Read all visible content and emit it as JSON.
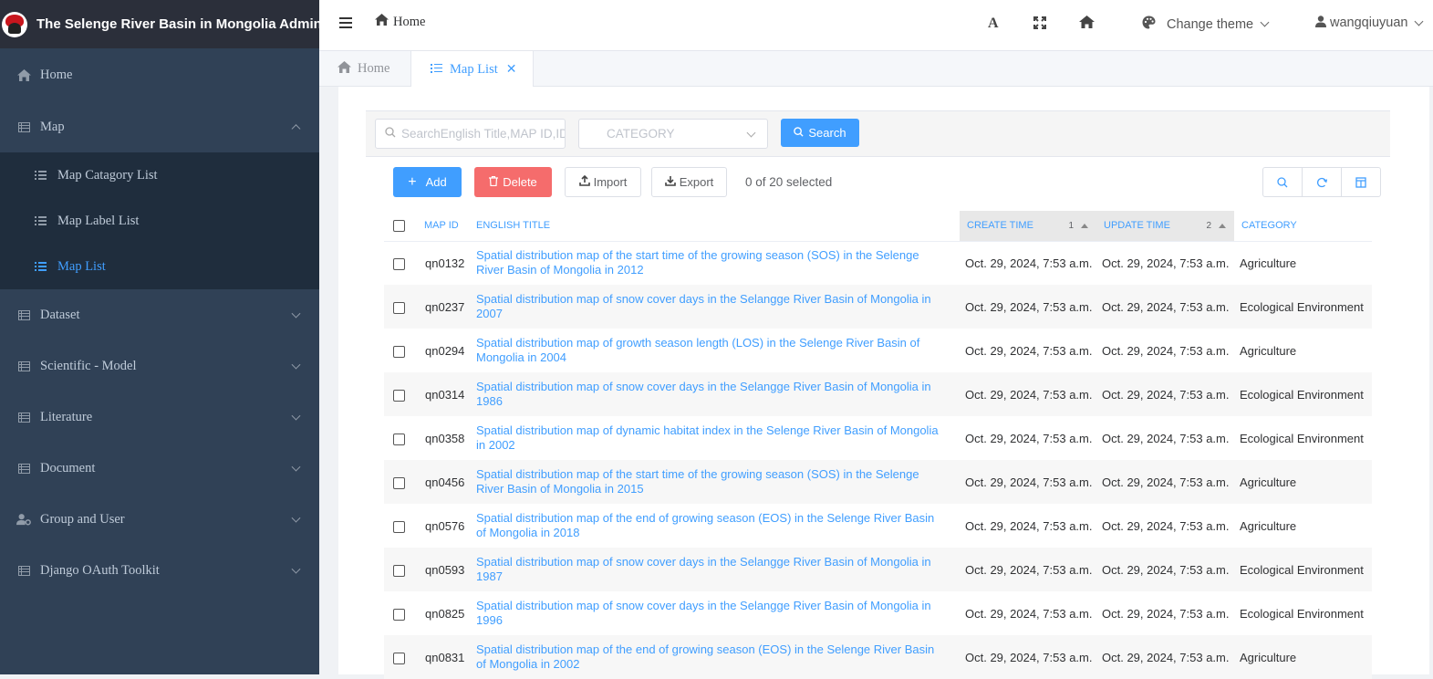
{
  "brand": {
    "title": "The Selenge River Basin in Mongolia Admin"
  },
  "sidebar": {
    "home": "Home",
    "map": "Map",
    "map_sub": [
      {
        "label": "Map Catagory List",
        "active": false
      },
      {
        "label": "Map Label List",
        "active": false
      },
      {
        "label": "Map List",
        "active": true
      }
    ],
    "sections": [
      "Dataset",
      "Scientific - Model",
      "Literature",
      "Document",
      "Group and User",
      "Django OAuth Toolkit"
    ]
  },
  "header": {
    "breadcrumb": "Home",
    "theme": "Change theme",
    "user": "wangqiuyuan",
    "font_icon": "A"
  },
  "tabs": {
    "home": "Home",
    "active": "Map List",
    "close": "✕"
  },
  "filter": {
    "search_placeholder": "SearchEnglish Title,MAP ID,ID",
    "category_placeholder": "CATEGORY",
    "search_button": "Search"
  },
  "toolbar": {
    "add": "Add",
    "delete": "Delete",
    "import": "Import",
    "export": "Export",
    "selected": "0 of 20 selected"
  },
  "table": {
    "headers": {
      "map_id": "MAP ID",
      "english_title": "ENGLISH TITLE",
      "create_time": "CREATE TIME",
      "create_sort": "1",
      "update_time": "UPDATE TIME",
      "update_sort": "2",
      "category": "CATEGORY"
    },
    "rows": [
      {
        "id": "qn0132",
        "title": "Spatial distribution map of the start time of the growing season (SOS) in the Selenge River Basin of Mongolia in 2012",
        "create": "Oct. 29, 2024, 7:53 a.m.",
        "update": "Oct. 29, 2024, 7:53 a.m.",
        "category": "Agriculture"
      },
      {
        "id": "qn0237",
        "title": "Spatial distribution map of snow cover days in the Selangge River Basin of Mongolia in 2007",
        "create": "Oct. 29, 2024, 7:53 a.m.",
        "update": "Oct. 29, 2024, 7:53 a.m.",
        "category": "Ecological Environment"
      },
      {
        "id": "qn0294",
        "title": "Spatial distribution map of growth season length (LOS) in the Selenge River Basin of Mongolia in 2004",
        "create": "Oct. 29, 2024, 7:53 a.m.",
        "update": "Oct. 29, 2024, 7:53 a.m.",
        "category": "Agriculture"
      },
      {
        "id": "qn0314",
        "title": "Spatial distribution map of snow cover days in the Selangge River Basin of Mongolia in 1986",
        "create": "Oct. 29, 2024, 7:53 a.m.",
        "update": "Oct. 29, 2024, 7:53 a.m.",
        "category": "Ecological Environment"
      },
      {
        "id": "qn0358",
        "title": "Spatial distribution map of dynamic habitat index in the Selenge River Basin of Mongolia in 2002",
        "create": "Oct. 29, 2024, 7:53 a.m.",
        "update": "Oct. 29, 2024, 7:53 a.m.",
        "category": "Ecological Environment"
      },
      {
        "id": "qn0456",
        "title": "Spatial distribution map of the start time of the growing season (SOS) in the Selenge River Basin of Mongolia in 2015",
        "create": "Oct. 29, 2024, 7:53 a.m.",
        "update": "Oct. 29, 2024, 7:53 a.m.",
        "category": "Agriculture"
      },
      {
        "id": "qn0576",
        "title": "Spatial distribution map of the end of growing season (EOS) in the Selenge River Basin of Mongolia in 2018",
        "create": "Oct. 29, 2024, 7:53 a.m.",
        "update": "Oct. 29, 2024, 7:53 a.m.",
        "category": "Agriculture"
      },
      {
        "id": "qn0593",
        "title": "Spatial distribution map of snow cover days in the Selangge River Basin of Mongolia in 1987",
        "create": "Oct. 29, 2024, 7:53 a.m.",
        "update": "Oct. 29, 2024, 7:53 a.m.",
        "category": "Ecological Environment"
      },
      {
        "id": "qn0825",
        "title": "Spatial distribution map of snow cover days in the Selangge River Basin of Mongolia in 1996",
        "create": "Oct. 29, 2024, 7:53 a.m.",
        "update": "Oct. 29, 2024, 7:53 a.m.",
        "category": "Ecological Environment"
      },
      {
        "id": "qn0831",
        "title": "Spatial distribution map of the end of growing season (EOS) in the Selenge River Basin of Mongolia in 2002",
        "create": "Oct. 29, 2024, 7:53 a.m.",
        "update": "Oct. 29, 2024, 7:53 a.m.",
        "category": "Agriculture"
      }
    ]
  },
  "colors": {
    "accent": "#409eff",
    "danger": "#f56c6c",
    "sidebar": "#304156",
    "submenu": "#1f2d3d"
  }
}
